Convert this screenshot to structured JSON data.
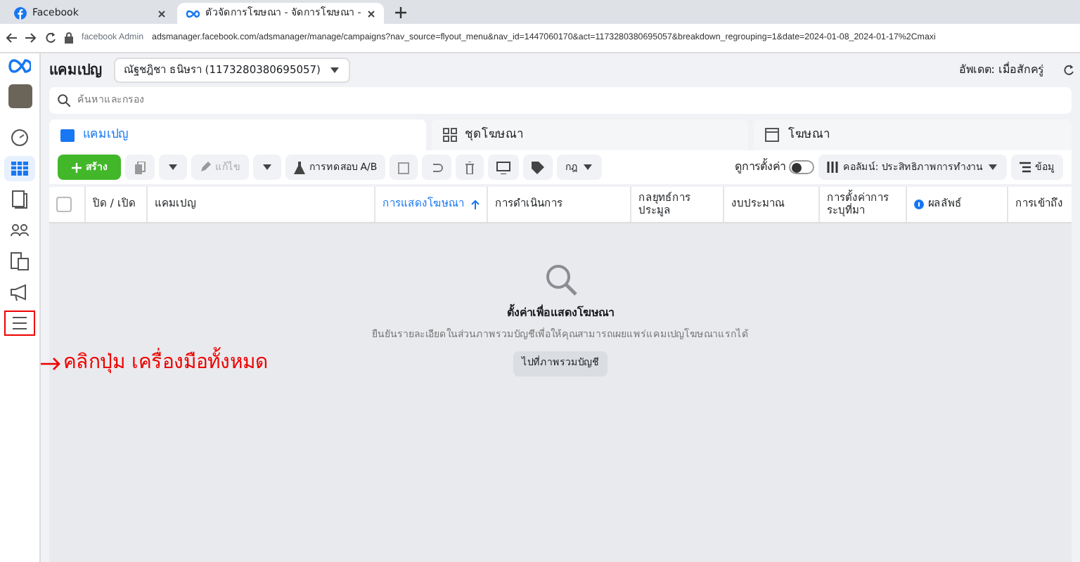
{
  "browser": {
    "tabs": [
      {
        "title": "Facebook",
        "selected": false
      },
      {
        "title": "ตัวจัดการโฆษณา - จัดการโฆษณา -",
        "selected": true
      }
    ],
    "site_label": "facebook Admin",
    "url": "adsmanager.facebook.com/adsmanager/manage/campaigns?nav_source=flyout_menu&nav_id=1447060170&act=1173280380695057&breakdown_regrouping=1&date=2024-01-08_2024-01-17%2Cmaxi"
  },
  "sidebar": {
    "items": [
      {
        "kind": "gauge",
        "selected": false,
        "highlighted": false
      },
      {
        "kind": "table",
        "selected": true,
        "highlighted": false
      },
      {
        "kind": "pages",
        "selected": false,
        "highlighted": false
      },
      {
        "kind": "people",
        "selected": false,
        "highlighted": false
      },
      {
        "kind": "stack",
        "selected": false,
        "highlighted": false
      },
      {
        "kind": "megaphone",
        "selected": false,
        "highlighted": false
      },
      {
        "kind": "menu",
        "selected": false,
        "highlighted": true
      }
    ]
  },
  "annotation": "คลิกปุ่ม เครื่องมือทั้งหมด",
  "header": {
    "title": "แคมเปญ",
    "account": "ณัฐชฎิชา ธนิษรา (1173280380695057)",
    "updated": "อัพเดต: เมื่อสักครู่"
  },
  "search": {
    "placeholder": "ค้นหาและกรอง"
  },
  "level_tabs": [
    {
      "label": "แคมเปญ",
      "kind": "campaign",
      "selected": true
    },
    {
      "label": "ชุดโฆษณา",
      "kind": "adset",
      "selected": false
    },
    {
      "label": "โฆษณา",
      "kind": "ad",
      "selected": false
    }
  ],
  "toolbar": {
    "create": "สร้าง",
    "edit": "แก้ไข",
    "ab_test": "การทดสอบ A/B",
    "rules": "กฎ",
    "view_setup": {
      "label": "ดูการตั้งค่า",
      "on": false
    },
    "columns": "คอลัมน์: ประสิทธิภาพการทำงาน",
    "breakdown": "ข้อมู"
  },
  "table": {
    "select_all": {
      "checked": false
    },
    "columns": [
      {
        "label": "ปิด / เปิด",
        "sorted": false,
        "info": false
      },
      {
        "label": "แคมเปญ",
        "sorted": false,
        "info": false
      },
      {
        "label": "การแสดงโฆษณา",
        "sorted": true,
        "info": false
      },
      {
        "label": "การดำเนินการ",
        "sorted": false,
        "info": false
      },
      {
        "label": "กลยุทธ์การประมูล",
        "sorted": false,
        "info": false
      },
      {
        "label": "งบประมาณ",
        "sorted": false,
        "info": false
      },
      {
        "label": "การตั้งค่าการระบุที่มา",
        "sorted": false,
        "info": false
      },
      {
        "label": "ผลลัพธ์",
        "sorted": false,
        "info": true
      },
      {
        "label": "การเข้าถึง",
        "sorted": false,
        "info": false
      }
    ]
  },
  "empty_state": {
    "title": "ตั้งค่าเพื่อแสดงโฆษณา",
    "message": "ยืนยันรายละเอียดในส่วนภาพรวมบัญชีเพื่อให้คุณสามารถเผยแพร่แคมเปญโฆษณาแรกได้",
    "button": "ไปที่ภาพรวมบัญชี"
  }
}
